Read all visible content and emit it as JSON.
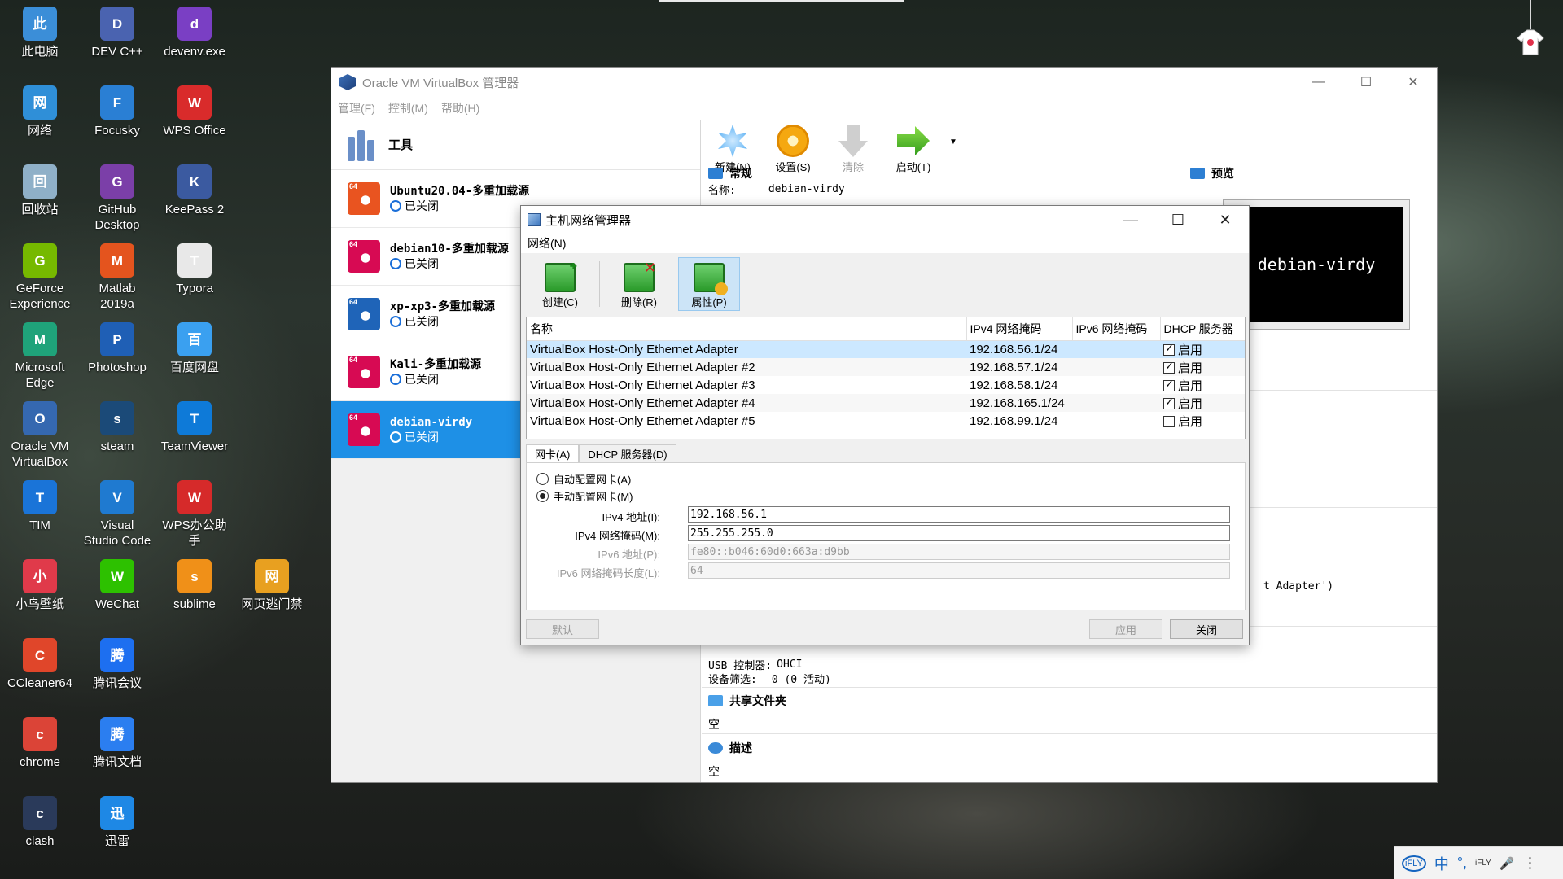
{
  "desktop": {
    "icons": [
      {
        "label": "此电脑",
        "icon": "computer-icon",
        "color": "#3b8ed8"
      },
      {
        "label": "DEV C++",
        "icon": "devcpp-icon",
        "color": "#4a63b0"
      },
      {
        "label": "devenv.exe",
        "icon": "visual-studio-icon",
        "color": "#7a3fc4"
      },
      {
        "label": "网络",
        "icon": "network-icon",
        "color": "#2f8fd8"
      },
      {
        "label": "Focusky",
        "icon": "focusky-icon",
        "color": "#2a7fd4"
      },
      {
        "label": "WPS Office",
        "icon": "wps-office-icon",
        "color": "#d92b2b"
      },
      {
        "label": "回收站",
        "icon": "recycle-bin-icon",
        "color": "#8fb0c8"
      },
      {
        "label": "GitHub Desktop",
        "icon": "github-desktop-icon",
        "color": "#7b3fa8"
      },
      {
        "label": "KeePass 2",
        "icon": "keepass-icon",
        "color": "#3b5aa0"
      },
      {
        "label": "GeForce Experience",
        "icon": "geforce-icon",
        "color": "#76b900"
      },
      {
        "label": "Matlab 2019a",
        "icon": "matlab-icon",
        "color": "#e4541e"
      },
      {
        "label": "Typora",
        "icon": "typora-icon",
        "color": "#e8e8e8"
      },
      {
        "label": "Microsoft Edge",
        "icon": "edge-icon",
        "color": "#1fa37a"
      },
      {
        "label": "Photoshop",
        "icon": "photoshop-icon",
        "color": "#1f5fb5"
      },
      {
        "label": "百度网盘",
        "icon": "baidu-netdisk-icon",
        "color": "#3aa0f0"
      },
      {
        "label": "Oracle VM VirtualBox",
        "icon": "virtualbox-icon",
        "color": "#3568b0"
      },
      {
        "label": "steam",
        "icon": "steam-icon",
        "color": "#1b4a78"
      },
      {
        "label": "TeamViewer",
        "icon": "teamviewer-icon",
        "color": "#0e7ad8"
      },
      {
        "label": "TIM",
        "icon": "tim-icon",
        "color": "#1a74d8"
      },
      {
        "label": "Visual Studio Code",
        "icon": "vscode-icon",
        "color": "#1f7ad0"
      },
      {
        "label": "WPS办公助手",
        "icon": "wps-assistant-icon",
        "color": "#d62a2a"
      },
      {
        "label": "小鸟壁纸",
        "icon": "bird-wallpaper-icon",
        "color": "#e03a4a"
      },
      {
        "label": "WeChat",
        "icon": "wechat-icon",
        "color": "#2dc100"
      },
      {
        "label": "sublime",
        "icon": "sublime-icon",
        "color": "#f09018"
      },
      {
        "label": "网页逃门禁",
        "icon": "webpage-icon",
        "color": "#e8a020"
      },
      {
        "label": "CCleaner64",
        "icon": "ccleaner-icon",
        "color": "#e0462a"
      },
      {
        "label": "腾讯会议",
        "icon": "tencent-meeting-icon",
        "color": "#1d6ff0"
      },
      {
        "label": "chrome",
        "icon": "chrome-icon",
        "color": "#db4437"
      },
      {
        "label": "腾讯文档",
        "icon": "tencent-docs-icon",
        "color": "#2b7ef0"
      },
      {
        "label": "clash",
        "icon": "clash-icon",
        "color": "#2a3a5a"
      },
      {
        "label": "迅雷",
        "icon": "xunlei-icon",
        "color": "#1e88e5"
      }
    ]
  },
  "virtualbox": {
    "title": "Oracle VM VirtualBox 管理器",
    "menu": [
      "管理(F)",
      "控制(M)",
      "帮助(H)"
    ],
    "tools_label": "工具",
    "vms": [
      {
        "name": "Ubuntu20.04-多重加载源",
        "state": "已关闭",
        "icon_color": "#e95420"
      },
      {
        "name": "debian10-多重加载源",
        "state": "已关闭",
        "icon_color": "#d70a53"
      },
      {
        "name": "xp-xp3-多重加载源",
        "state": "已关闭",
        "icon_color": "#1f64b8"
      },
      {
        "name": "Kali-多重加载源",
        "state": "已关闭",
        "icon_color": "#d70a53"
      },
      {
        "name": "debian-virdy",
        "state": "已关闭",
        "icon_color": "#d70a53"
      }
    ],
    "toolbar": {
      "new": "新建(N)",
      "settings": "设置(S)",
      "discard": "清除",
      "start": "启动(T)"
    },
    "details": {
      "general_title": "常规",
      "name_label": "名称:",
      "name_value": "debian-virdy",
      "preview_title": "预览",
      "preview_text": "debian-virdy",
      "adapter_fragment": "t Adapter')",
      "usb_controller_label": "USB 控制器:",
      "usb_controller_value": "OHCI",
      "device_filter_label": "设备筛选:",
      "device_filter_value": "0 (0 活动)",
      "shared_folders_title": "共享文件夹",
      "shared_folders_value": "空",
      "description_title": "描述",
      "description_value": "空"
    }
  },
  "host_network_dialog": {
    "title": "主机网络管理器",
    "menu": "网络(N)",
    "buttons": {
      "create": "创建(C)",
      "remove": "删除(R)",
      "properties": "属性(P)"
    },
    "columns": [
      "名称",
      "IPv4 网络掩码",
      "IPv6 网络掩码",
      "DHCP 服务器"
    ],
    "adapters": [
      {
        "name": "VirtualBox Host-Only Ethernet Adapter",
        "ipv4": "192.168.56.1/24",
        "ipv6": "",
        "dhcp_enabled": true,
        "dhcp_label": "启用"
      },
      {
        "name": "VirtualBox Host-Only Ethernet Adapter #2",
        "ipv4": "192.168.57.1/24",
        "ipv6": "",
        "dhcp_enabled": true,
        "dhcp_label": "启用"
      },
      {
        "name": "VirtualBox Host-Only Ethernet Adapter #3",
        "ipv4": "192.168.58.1/24",
        "ipv6": "",
        "dhcp_enabled": true,
        "dhcp_label": "启用"
      },
      {
        "name": "VirtualBox Host-Only Ethernet Adapter #4",
        "ipv4": "192.168.165.1/24",
        "ipv6": "",
        "dhcp_enabled": true,
        "dhcp_label": "启用"
      },
      {
        "name": "VirtualBox Host-Only Ethernet Adapter #5",
        "ipv4": "192.168.99.1/24",
        "ipv6": "",
        "dhcp_enabled": false,
        "dhcp_label": "启用"
      }
    ],
    "tabs": [
      "网卡(A)",
      "DHCP 服务器(D)"
    ],
    "radio_auto": "自动配置网卡(A)",
    "radio_manual": "手动配置网卡(M)",
    "fields": {
      "ipv4_addr_label": "IPv4 地址(I):",
      "ipv4_addr_value": "192.168.56.1",
      "ipv4_mask_label": "IPv4 网络掩码(M):",
      "ipv4_mask_value": "255.255.255.0",
      "ipv6_addr_label": "IPv6 地址(P):",
      "ipv6_addr_value": "fe80::b046:60d0:663a:d9bb",
      "ipv6_prefix_label": "IPv6 网络掩码长度(L):",
      "ipv6_prefix_value": "64"
    },
    "footer": {
      "reset": "默认",
      "apply": "应用",
      "close": "关闭"
    }
  },
  "tray": {
    "items": [
      "iFLY",
      "中",
      "°,",
      "iFLY",
      "🎤",
      "⋮"
    ]
  }
}
